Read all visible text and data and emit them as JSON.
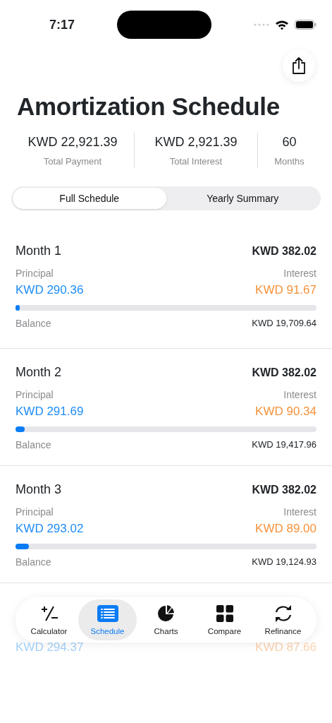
{
  "status_bar": {
    "time": "7:17"
  },
  "title": "Amortization Schedule",
  "summary": [
    {
      "value": "KWD 22,921.39",
      "label": "Total Payment"
    },
    {
      "value": "KWD 2,921.39",
      "label": "Total Interest"
    },
    {
      "value": "60",
      "label": "Months"
    }
  ],
  "segments": [
    {
      "label": "Full Schedule",
      "selected": true
    },
    {
      "label": "Yearly Summary",
      "selected": false
    }
  ],
  "months": [
    {
      "title": "Month 1",
      "total": "KWD 382.02",
      "principal_label": "Principal",
      "principal": "KWD 290.36",
      "interest_label": "Interest",
      "interest": "KWD 91.67",
      "level": 0.015,
      "balance_label": "Balance",
      "balance": "KWD 19,709.64"
    },
    {
      "title": "Month 2",
      "total": "KWD 382.02",
      "principal_label": "Principal",
      "principal": "KWD 291.69",
      "interest_label": "Interest",
      "interest": "KWD 90.34",
      "level": 0.03,
      "balance_label": "Balance",
      "balance": "KWD 19,417.96"
    },
    {
      "title": "Month 3",
      "total": "KWD 382.02",
      "principal_label": "Principal",
      "principal": "KWD 293.02",
      "interest_label": "Interest",
      "interest": "KWD 89.00",
      "level": 0.045,
      "balance_label": "Balance",
      "balance": "KWD 19,124.93"
    },
    {
      "principal": "KWD 294.37",
      "interest": "KWD 87.66"
    }
  ],
  "tab_bar": [
    {
      "label": "Calculator",
      "kind": "plusminus",
      "selected": false
    },
    {
      "label": "Schedule",
      "kind": "list",
      "selected": true
    },
    {
      "label": "Charts",
      "kind": "pie",
      "selected": false
    },
    {
      "label": "Compare",
      "kind": "grid",
      "selected": false
    },
    {
      "label": "Refinance",
      "kind": "cycle",
      "selected": false
    }
  ]
}
